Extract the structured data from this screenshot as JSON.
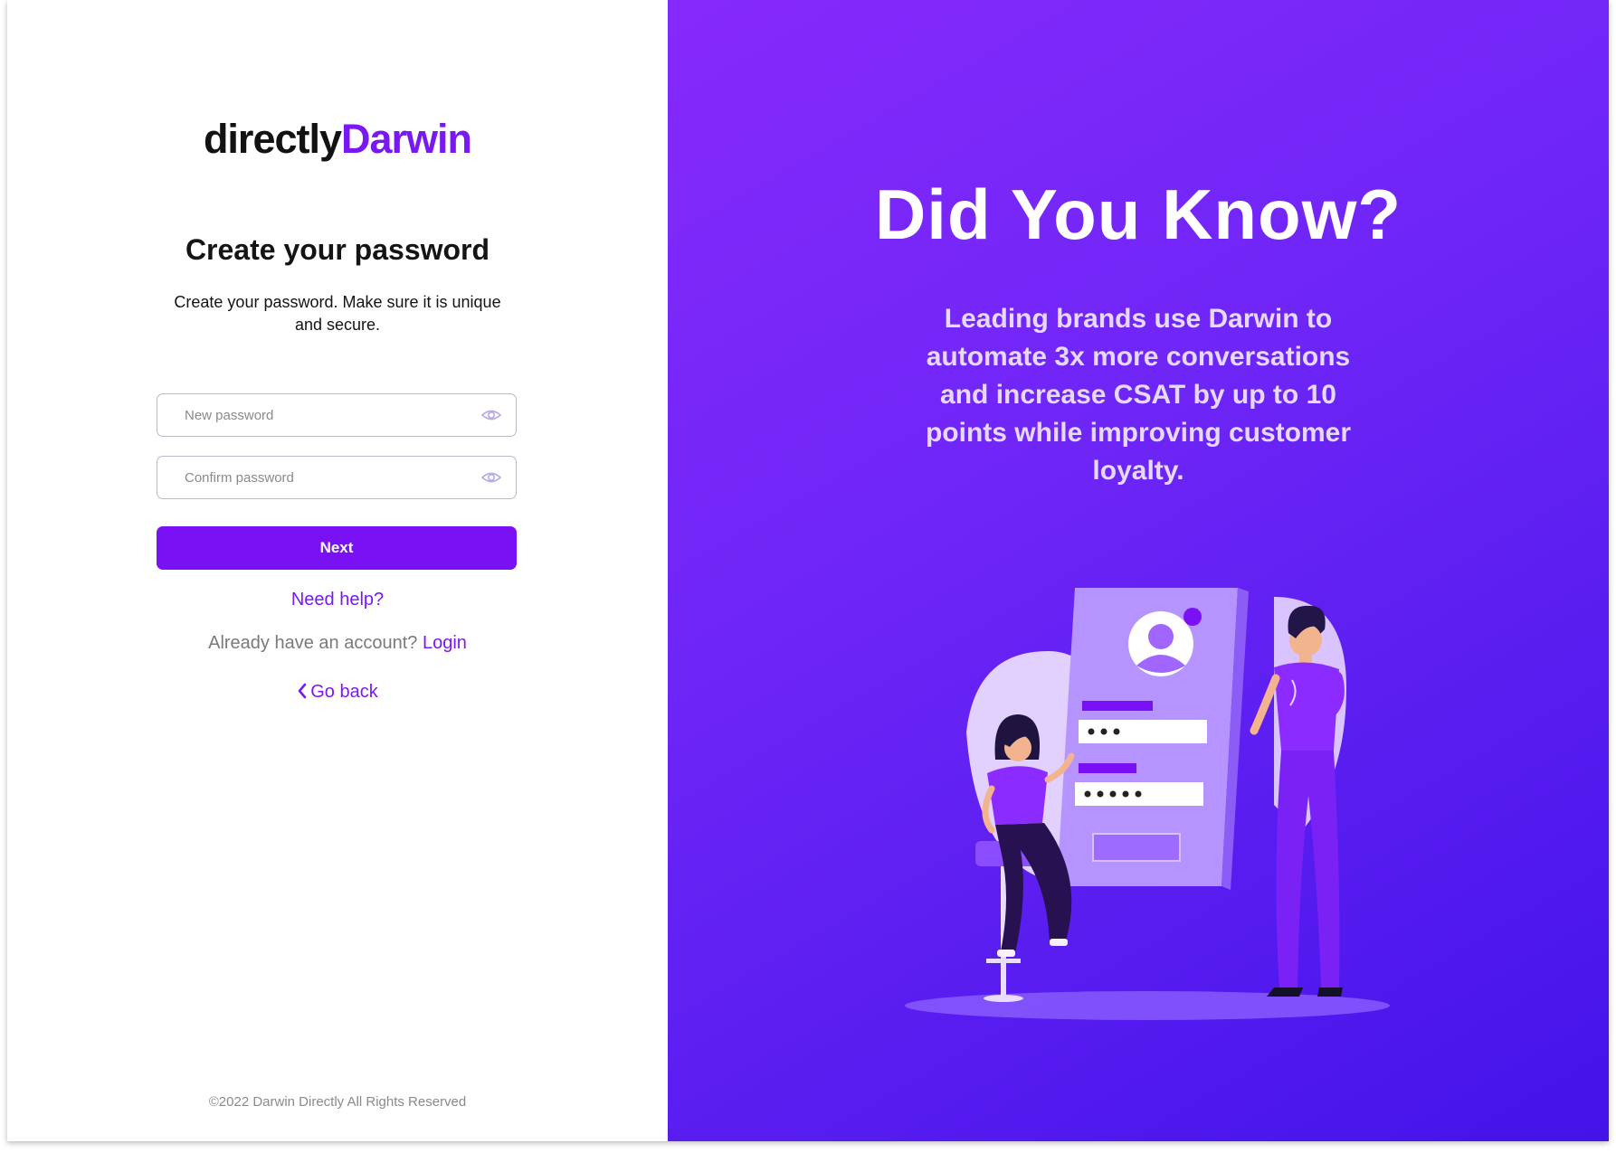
{
  "brand": {
    "part1": "directly",
    "part2": "Darwin"
  },
  "form": {
    "title": "Create your password",
    "subtitle": "Create your password. Make sure it is unique and secure.",
    "new_password_placeholder": "New password",
    "confirm_password_placeholder": "Confirm password",
    "next_label": "Next",
    "need_help": "Need help?",
    "have_account_text": "Already have an account?",
    "login_label": "Login",
    "go_back_label": "Go back"
  },
  "footer": {
    "copyright": "©2022 Darwin Directly All Rights Reserved"
  },
  "promo": {
    "heading": "Did You Know?",
    "body": "Leading brands use Darwin to automate 3x more conversations and increase CSAT by up to 10 points while improving customer loyalty."
  },
  "colors": {
    "accent": "#7a11f5",
    "panel_start": "#8629fc",
    "panel_end": "#4313ea"
  },
  "icons": {
    "password_toggle": "eye-icon",
    "back": "chevron-left-icon"
  }
}
